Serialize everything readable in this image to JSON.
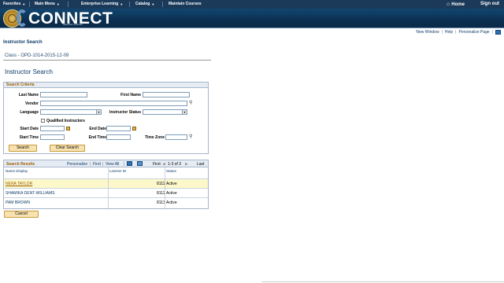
{
  "topnav": {
    "favorites": "Favorites",
    "main_menu": "Main Menu",
    "enterprise_learning": "Enterprise Learning",
    "catalog": "Catalog",
    "maintain_courses": "Maintain Courses",
    "home": "Home",
    "sign_out": "Sign out"
  },
  "banner": {
    "logo_text": "CONNECT",
    "logo_sub": "Maryland Judiciary"
  },
  "utilbar": {
    "new_window": "New Window",
    "help": "Help",
    "personalize_page": "Personalize Page"
  },
  "page": {
    "heading": "Instructor Search",
    "class_line": "Class - OPD-1014-2015-12-09",
    "sub_heading": "Instructor Search"
  },
  "criteria": {
    "title": "Search Criteria",
    "last_name_label": "Last Name",
    "first_name_label": "First Name",
    "vendor_label": "Vendor",
    "language_label": "Language",
    "instructor_status_label": "Instructor Status",
    "qualified_label": "Qualified Instructors",
    "start_date_label": "Start Date",
    "end_date_label": "End Date",
    "start_time_label": "Start Time",
    "end_time_label": "End Time",
    "time_zone_label": "Time Zone",
    "search_btn": "Search",
    "clear_btn": "Clear Search"
  },
  "results": {
    "title": "Search Results",
    "personalize": "Personalize",
    "find": "Find",
    "view_all": "View All",
    "first": "First",
    "range": "1-3 of 3",
    "last": "Last",
    "columns": [
      "Name Display",
      "Learner ID",
      "Status"
    ],
    "rows": [
      {
        "name": "NENA TAYLOR",
        "id": "8111",
        "status": "Active"
      },
      {
        "name": "SHAMIKA DENT-WILLIAMS",
        "id": "8112",
        "status": "Active"
      },
      {
        "name": "PAM BROWN",
        "id": "8113",
        "status": "Active"
      }
    ]
  },
  "cancel_btn": "Cancel"
}
